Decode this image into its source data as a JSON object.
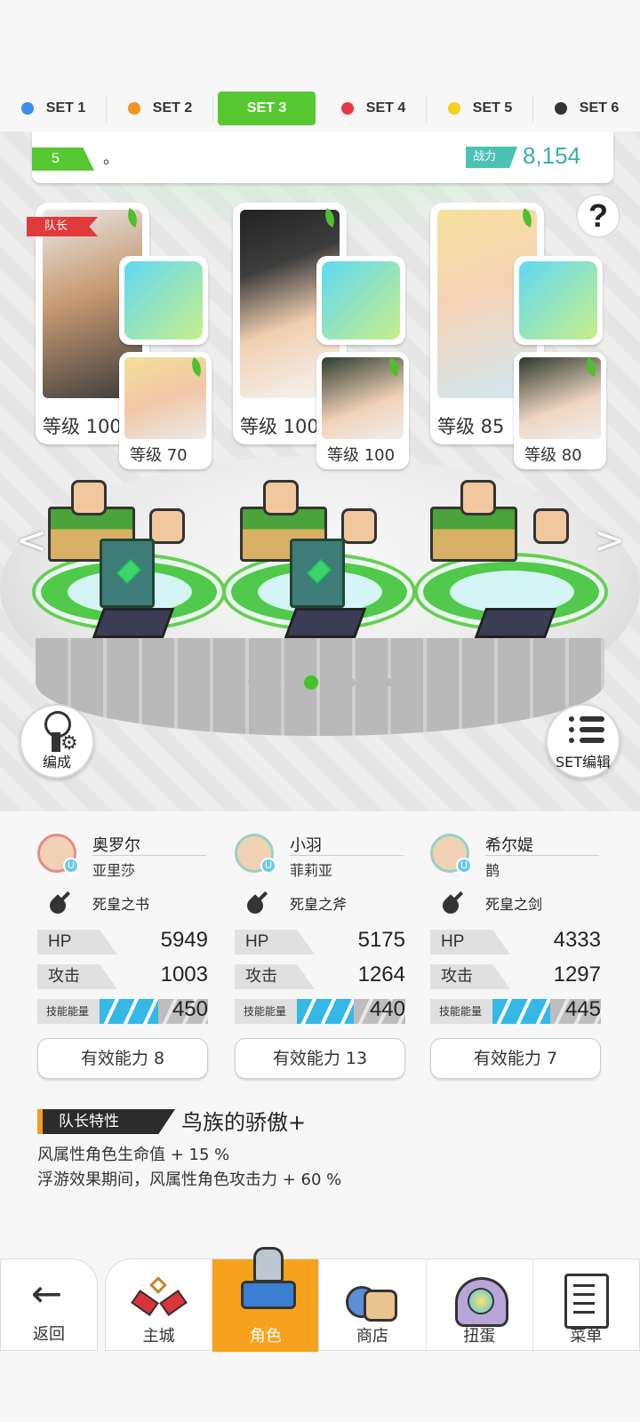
{
  "set_tabs": [
    {
      "label": "SET 1",
      "color": "#3d8ee8",
      "active": false
    },
    {
      "label": "SET 2",
      "color": "#f4931e",
      "active": false
    },
    {
      "label": "SET 3",
      "color": "#56c832",
      "active": true
    },
    {
      "label": "SET 4",
      "color": "#e63945",
      "active": false
    },
    {
      "label": "SET 5",
      "color": "#f4d21e",
      "active": false
    },
    {
      "label": "SET 6",
      "color": "#333333",
      "active": false
    }
  ],
  "info_bar": {
    "level": "5",
    "text": "。",
    "power_label": "战力",
    "power_value": "8,154"
  },
  "help_label": "?",
  "leader_tag": "队长",
  "teams": [
    {
      "main_level": "等级 100",
      "sub_level": "等级 70",
      "equip_icon": "book-icon"
    },
    {
      "main_level": "等级 100",
      "sub_level": "等级 100",
      "equip_icon": "axe-icon"
    },
    {
      "main_level": "等级 85",
      "sub_level": "等级 80",
      "equip_icon": "sword-icon"
    }
  ],
  "nav_arrows": {
    "left": "<",
    "right": ">"
  },
  "pager": {
    "count": 10,
    "active_index": 4
  },
  "formation_button": "编成",
  "set_edit_button": "SET编辑",
  "stats": [
    {
      "name": "奥罗尔",
      "partner": "亚里莎",
      "weapon": "死皇之书",
      "hp_label": "HP",
      "hp": "5949",
      "atk_label": "攻击",
      "atk": "1003",
      "energy_label": "技能能量",
      "energy": "450",
      "energy_fill": 0.45,
      "ability": "有效能力 8"
    },
    {
      "name": "小羽",
      "partner": "菲莉亚",
      "weapon": "死皇之斧",
      "hp_label": "HP",
      "hp": "5175",
      "atk_label": "攻击",
      "atk": "1264",
      "energy_label": "技能能量",
      "energy": "440",
      "energy_fill": 0.44,
      "ability": "有效能力 13"
    },
    {
      "name": "希尔媞",
      "partner": "鹊",
      "weapon": "死皇之剑",
      "hp_label": "HP",
      "hp": "4333",
      "atk_label": "攻击",
      "atk": "1297",
      "energy_label": "技能能量",
      "energy": "445",
      "energy_fill": 0.445,
      "ability": "有效能力 7"
    }
  ],
  "leader_trait": {
    "label": "队长特性",
    "title": "鸟族的骄傲+",
    "lines": [
      "风属性角色生命值 + 15 %",
      "浮游效果期间，风属性角色攻击力 + 60 %"
    ]
  },
  "bottom_nav": {
    "back": "返回",
    "items": [
      {
        "label": "主城",
        "icon": "castle-icon",
        "active": false
      },
      {
        "label": "角色",
        "icon": "character-icon",
        "active": true
      },
      {
        "label": "商店",
        "icon": "shop-icon",
        "active": false
      },
      {
        "label": "扭蛋",
        "icon": "gacha-icon",
        "active": false
      },
      {
        "label": "菜单",
        "icon": "menu-icon",
        "active": false
      }
    ]
  }
}
